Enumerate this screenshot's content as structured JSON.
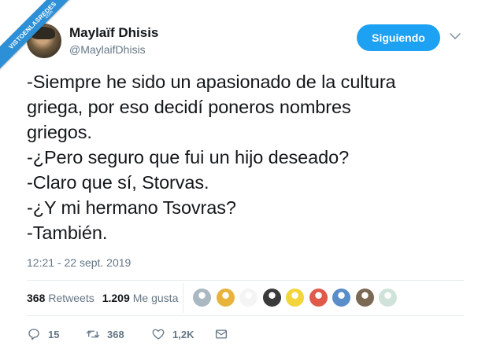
{
  "watermark": {
    "text": "VISTOENLASREDES",
    "sub": ".com",
    "color": "#2d8fd5"
  },
  "author": {
    "display_name": "Maylaïf Dhisis",
    "handle": "@MaylaifDhisis"
  },
  "follow_button": {
    "label": "Siguiendo",
    "color": "#1da1f2"
  },
  "tweet": {
    "text": "-Siempre he sido un apasionado de la cultura\ngriega, por eso decidí poneros nombres\ngriegos.\n-¿Pero seguro que fui un hijo deseado?\n-Claro que sí, Storvas.\n-¿Y mi hermano Tsovras?\n-También.",
    "timestamp": "12:21 - 22 sept. 2019"
  },
  "stats": {
    "retweets_count": "368",
    "retweets_label": "Retweets",
    "likes_count": "1.209",
    "likes_label": "Me gusta"
  },
  "likers": [
    {
      "icon": "default-avatar",
      "color": "#aab8c2"
    },
    {
      "icon": "cartoon-avatar",
      "color": "#e8b33a"
    },
    {
      "icon": "anime-avatar",
      "color": "#f4f4f4"
    },
    {
      "icon": "dark-avatar",
      "color": "#3a3a3a"
    },
    {
      "icon": "yellow-cartoon-avatar",
      "color": "#f2d43b"
    },
    {
      "icon": "mermaid-avatar",
      "color": "#e05a4a"
    },
    {
      "icon": "illustration-avatar",
      "color": "#5b8ec9"
    },
    {
      "icon": "photo-avatar",
      "color": "#7a6a55"
    },
    {
      "icon": "pastel-avatar",
      "color": "#cfe3d8"
    }
  ],
  "actions": {
    "replies": "15",
    "retweets": "368",
    "likes": "1,2K"
  }
}
